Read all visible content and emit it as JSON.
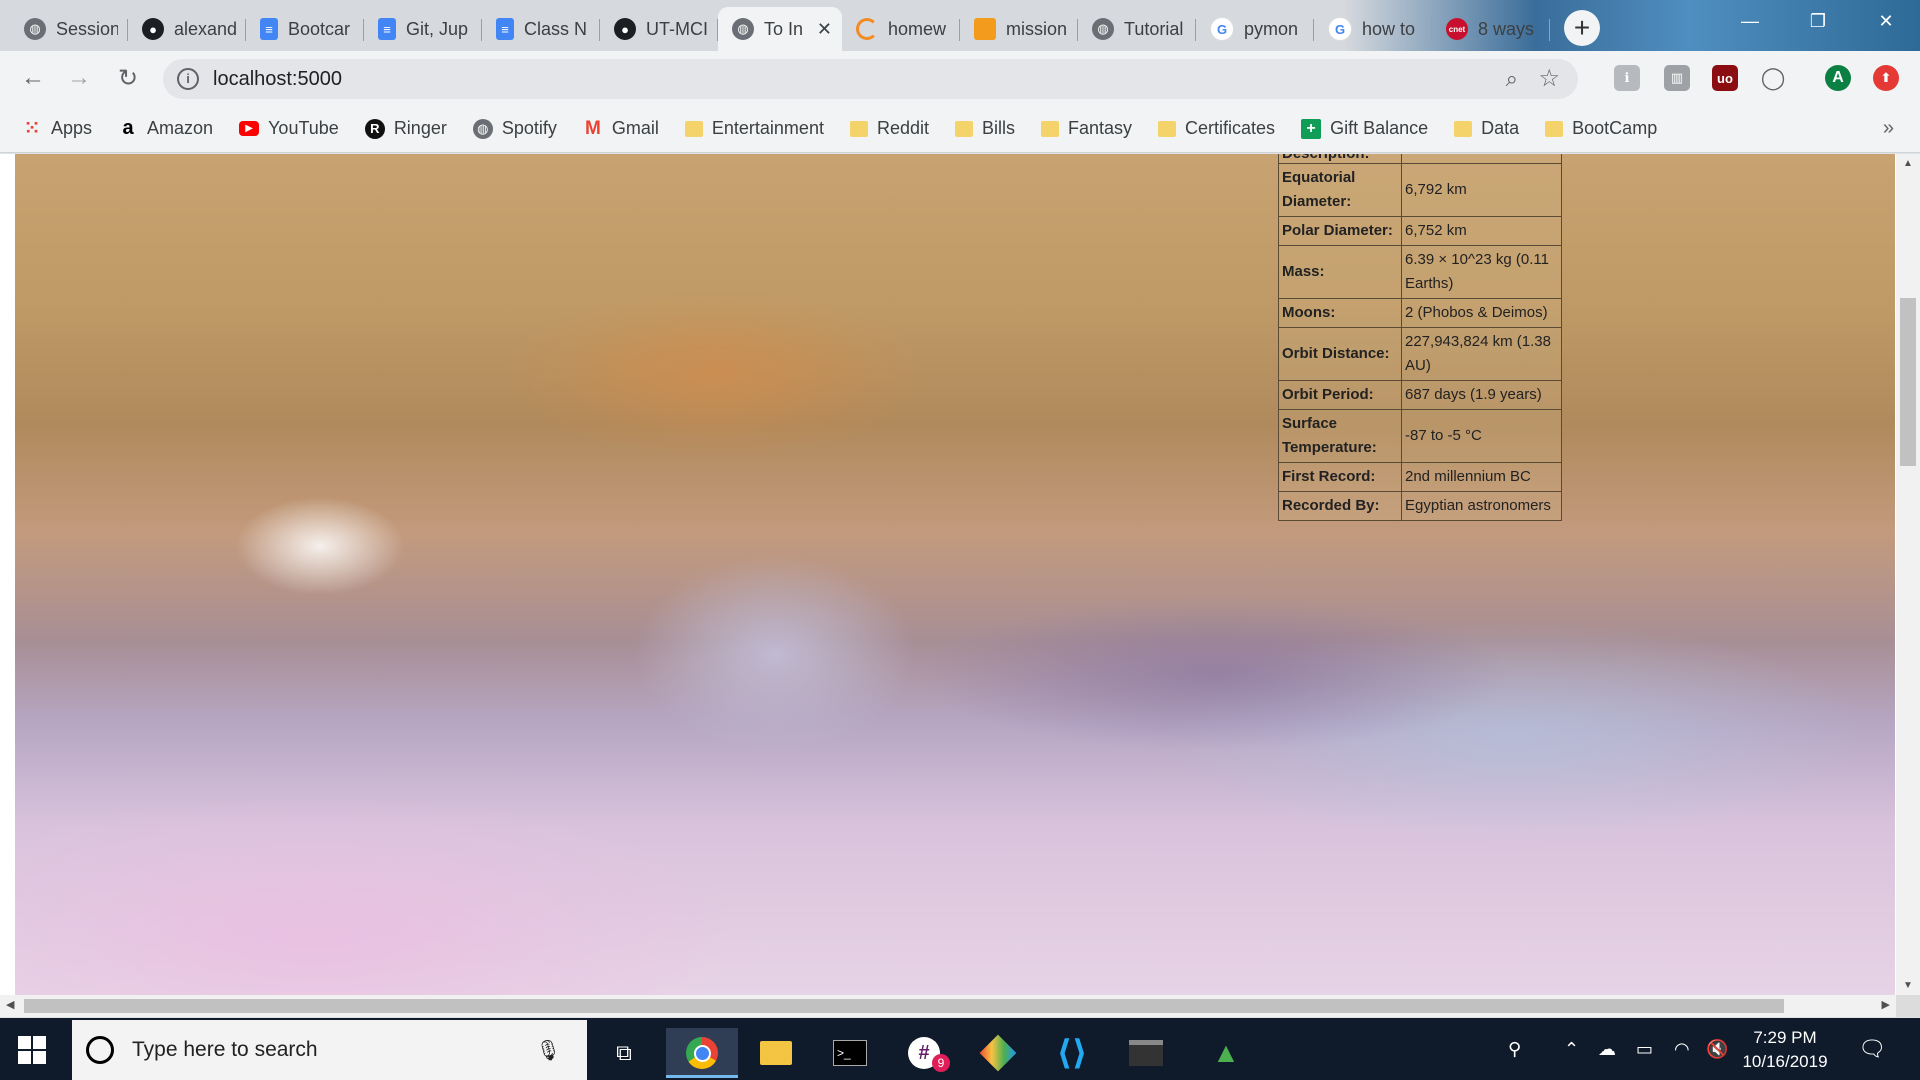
{
  "tabs": [
    {
      "label": "Session",
      "icon": "globe-icon"
    },
    {
      "label": "alexand",
      "icon": "github-icon"
    },
    {
      "label": "Bootcar",
      "icon": "docs-icon"
    },
    {
      "label": "Git, Jup",
      "icon": "docs-icon"
    },
    {
      "label": "Class N",
      "icon": "docs-icon"
    },
    {
      "label": "UT-MCI",
      "icon": "github-icon"
    },
    {
      "label": "To In",
      "icon": "globe-icon",
      "active": true
    },
    {
      "label": "homew",
      "icon": "loading-icon"
    },
    {
      "label": "mission",
      "icon": "book-icon"
    },
    {
      "label": "Tutorial",
      "icon": "globe-icon"
    },
    {
      "label": "pymon",
      "icon": "google-icon"
    },
    {
      "label": "how to",
      "icon": "google-icon"
    },
    {
      "label": "8 ways",
      "icon": "cnet-icon",
      "icon_text": "cnet"
    }
  ],
  "address": {
    "url": "localhost:5000"
  },
  "bookmarks": [
    {
      "label": "Apps",
      "icon": "apps-grid-icon"
    },
    {
      "label": "Amazon",
      "icon": "amazon-icon",
      "icon_text": "a"
    },
    {
      "label": "YouTube",
      "icon": "youtube-icon"
    },
    {
      "label": "Ringer",
      "icon": "ringer-icon",
      "icon_text": "R"
    },
    {
      "label": "Spotify",
      "icon": "globe-icon"
    },
    {
      "label": "Gmail",
      "icon": "gmail-icon",
      "icon_text": "M"
    },
    {
      "label": "Entertainment",
      "icon": "folder-icon"
    },
    {
      "label": "Reddit",
      "icon": "folder-icon"
    },
    {
      "label": "Bills",
      "icon": "folder-icon"
    },
    {
      "label": "Fantasy",
      "icon": "folder-icon"
    },
    {
      "label": "Certificates",
      "icon": "folder-icon"
    },
    {
      "label": "Gift Balance",
      "icon": "sheets-icon"
    },
    {
      "label": "Data",
      "icon": "folder-icon"
    },
    {
      "label": "BootCamp",
      "icon": "folder-icon"
    }
  ],
  "facts": {
    "cut_row": "Description:",
    "rows": [
      {
        "key": "Equatorial Diameter:",
        "value": "6,792 km"
      },
      {
        "key": "Polar Diameter:",
        "value": "6,752 km"
      },
      {
        "key": "Mass:",
        "value": "6.39 × 10^23 kg (0.11 Earths)"
      },
      {
        "key": "Moons:",
        "value": "2 (Phobos & Deimos)"
      },
      {
        "key": "Orbit Distance:",
        "value": "227,943,824 km (1.38 AU)"
      },
      {
        "key": "Orbit Period:",
        "value": "687 days (1.9 years)"
      },
      {
        "key": "Surface Temperature:",
        "value": "-87 to -5 °C"
      },
      {
        "key": "First Record:",
        "value": "2nd millennium BC"
      },
      {
        "key": "Recorded By:",
        "value": "Egyptian astronomers"
      }
    ]
  },
  "extensions": {
    "profile_initial": "A",
    "ublock_text": "uo"
  },
  "taskbar": {
    "search_placeholder": "Type here to search",
    "slack_badge": "9",
    "time": "7:29 PM",
    "date": "10/16/2019"
  },
  "colors": {
    "accent": "#4285f4",
    "taskbar": "#0f1a2a"
  }
}
